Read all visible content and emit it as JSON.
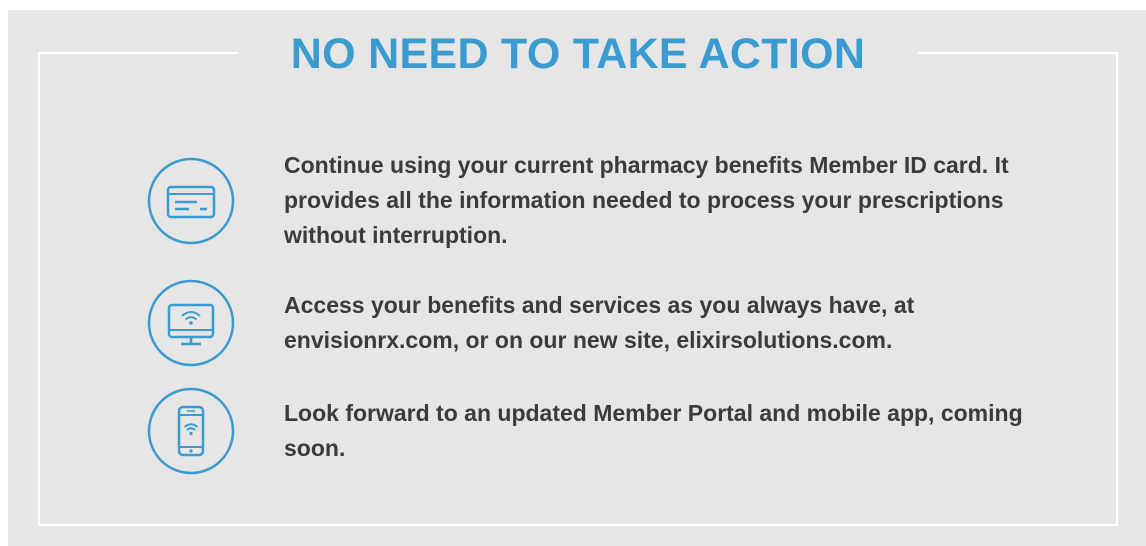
{
  "title": "NO NEED TO TAKE ACTION",
  "colors": {
    "background": "#e6e6e6",
    "accent": "#3a9bd1",
    "text": "#3b3b3b",
    "frame": "#ffffff"
  },
  "items": [
    {
      "icon": "id-card-icon",
      "text": "Continue using your current pharmacy benefits Member ID card. It provides all the information needed to process your prescriptions without interruption."
    },
    {
      "icon": "desktop-wifi-icon",
      "text": "Access your benefits and services as you always have, at envisionrx.com, or on our new site, elixirsolutions.com."
    },
    {
      "icon": "mobile-wifi-icon",
      "text": "Look forward to an updated Member Portal and mobile app, coming soon."
    }
  ]
}
